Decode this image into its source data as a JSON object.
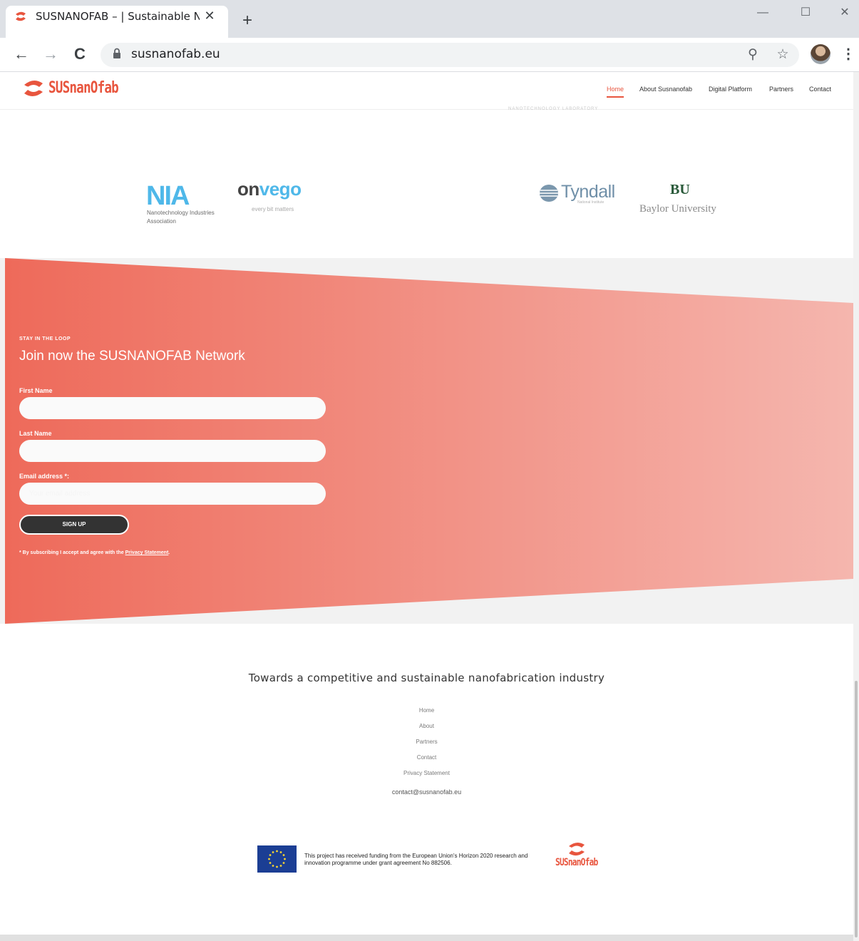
{
  "browser": {
    "tab_title": "SUSNANOFAB – | Sustainable Na",
    "tab_close": "✕",
    "new_tab": "+",
    "url": "susnanofab.eu",
    "minimize": "—",
    "maximize": "☐",
    "close": "✕",
    "back": "←",
    "forward": "→",
    "reload": "C",
    "zoom": "⚲",
    "bookmark": "☆",
    "menu": "⋮"
  },
  "site": {
    "logo_text": "SUSnanOfab",
    "nav": [
      "Home",
      "About Susnanofab",
      "Digital Platform",
      "Partners",
      "Contact"
    ]
  },
  "partners": {
    "faint_logo": "NANOTECHNOLOGY LABORATORY",
    "nia": "NIA",
    "nia_sub": "Nanotechnology Industries Association",
    "onvego": "onvego",
    "onvego_sub": "every bit matters",
    "tyndall": "Tyndall",
    "tyndall_sub": "National Institute",
    "baylor_mark": "BU",
    "baylor": "Baylor University"
  },
  "newsletter": {
    "eyebrow": "STAY IN THE LOOP",
    "title": "Join now the SUSNANOFAB Network",
    "first_name_label": "First Name",
    "last_name_label": "Last Name",
    "email_label": "Email address *:",
    "email_placeholder": "Your email address",
    "signup": "SIGN UP",
    "consent_prefix": "* By subscribing I accept and agree with the ",
    "consent_link": "Privacy Statement",
    "consent_suffix": "."
  },
  "footer": {
    "tagline": "Towards a competitive and sustainable nanofabrication industry",
    "links": [
      "Home",
      "About",
      "Partners",
      "Contact",
      "Privacy Statement"
    ],
    "email": "contact@susnanofab.eu",
    "eu_text": "This project has received funding from the European Union's Horizon 2020 research and innovation programme under grant agreement No 882506.",
    "logo_text": "SUSnanOfab"
  },
  "colors": {
    "brand": "#e8553e",
    "band_start": "#ee6a5a",
    "band_end": "#f5b6ae"
  }
}
